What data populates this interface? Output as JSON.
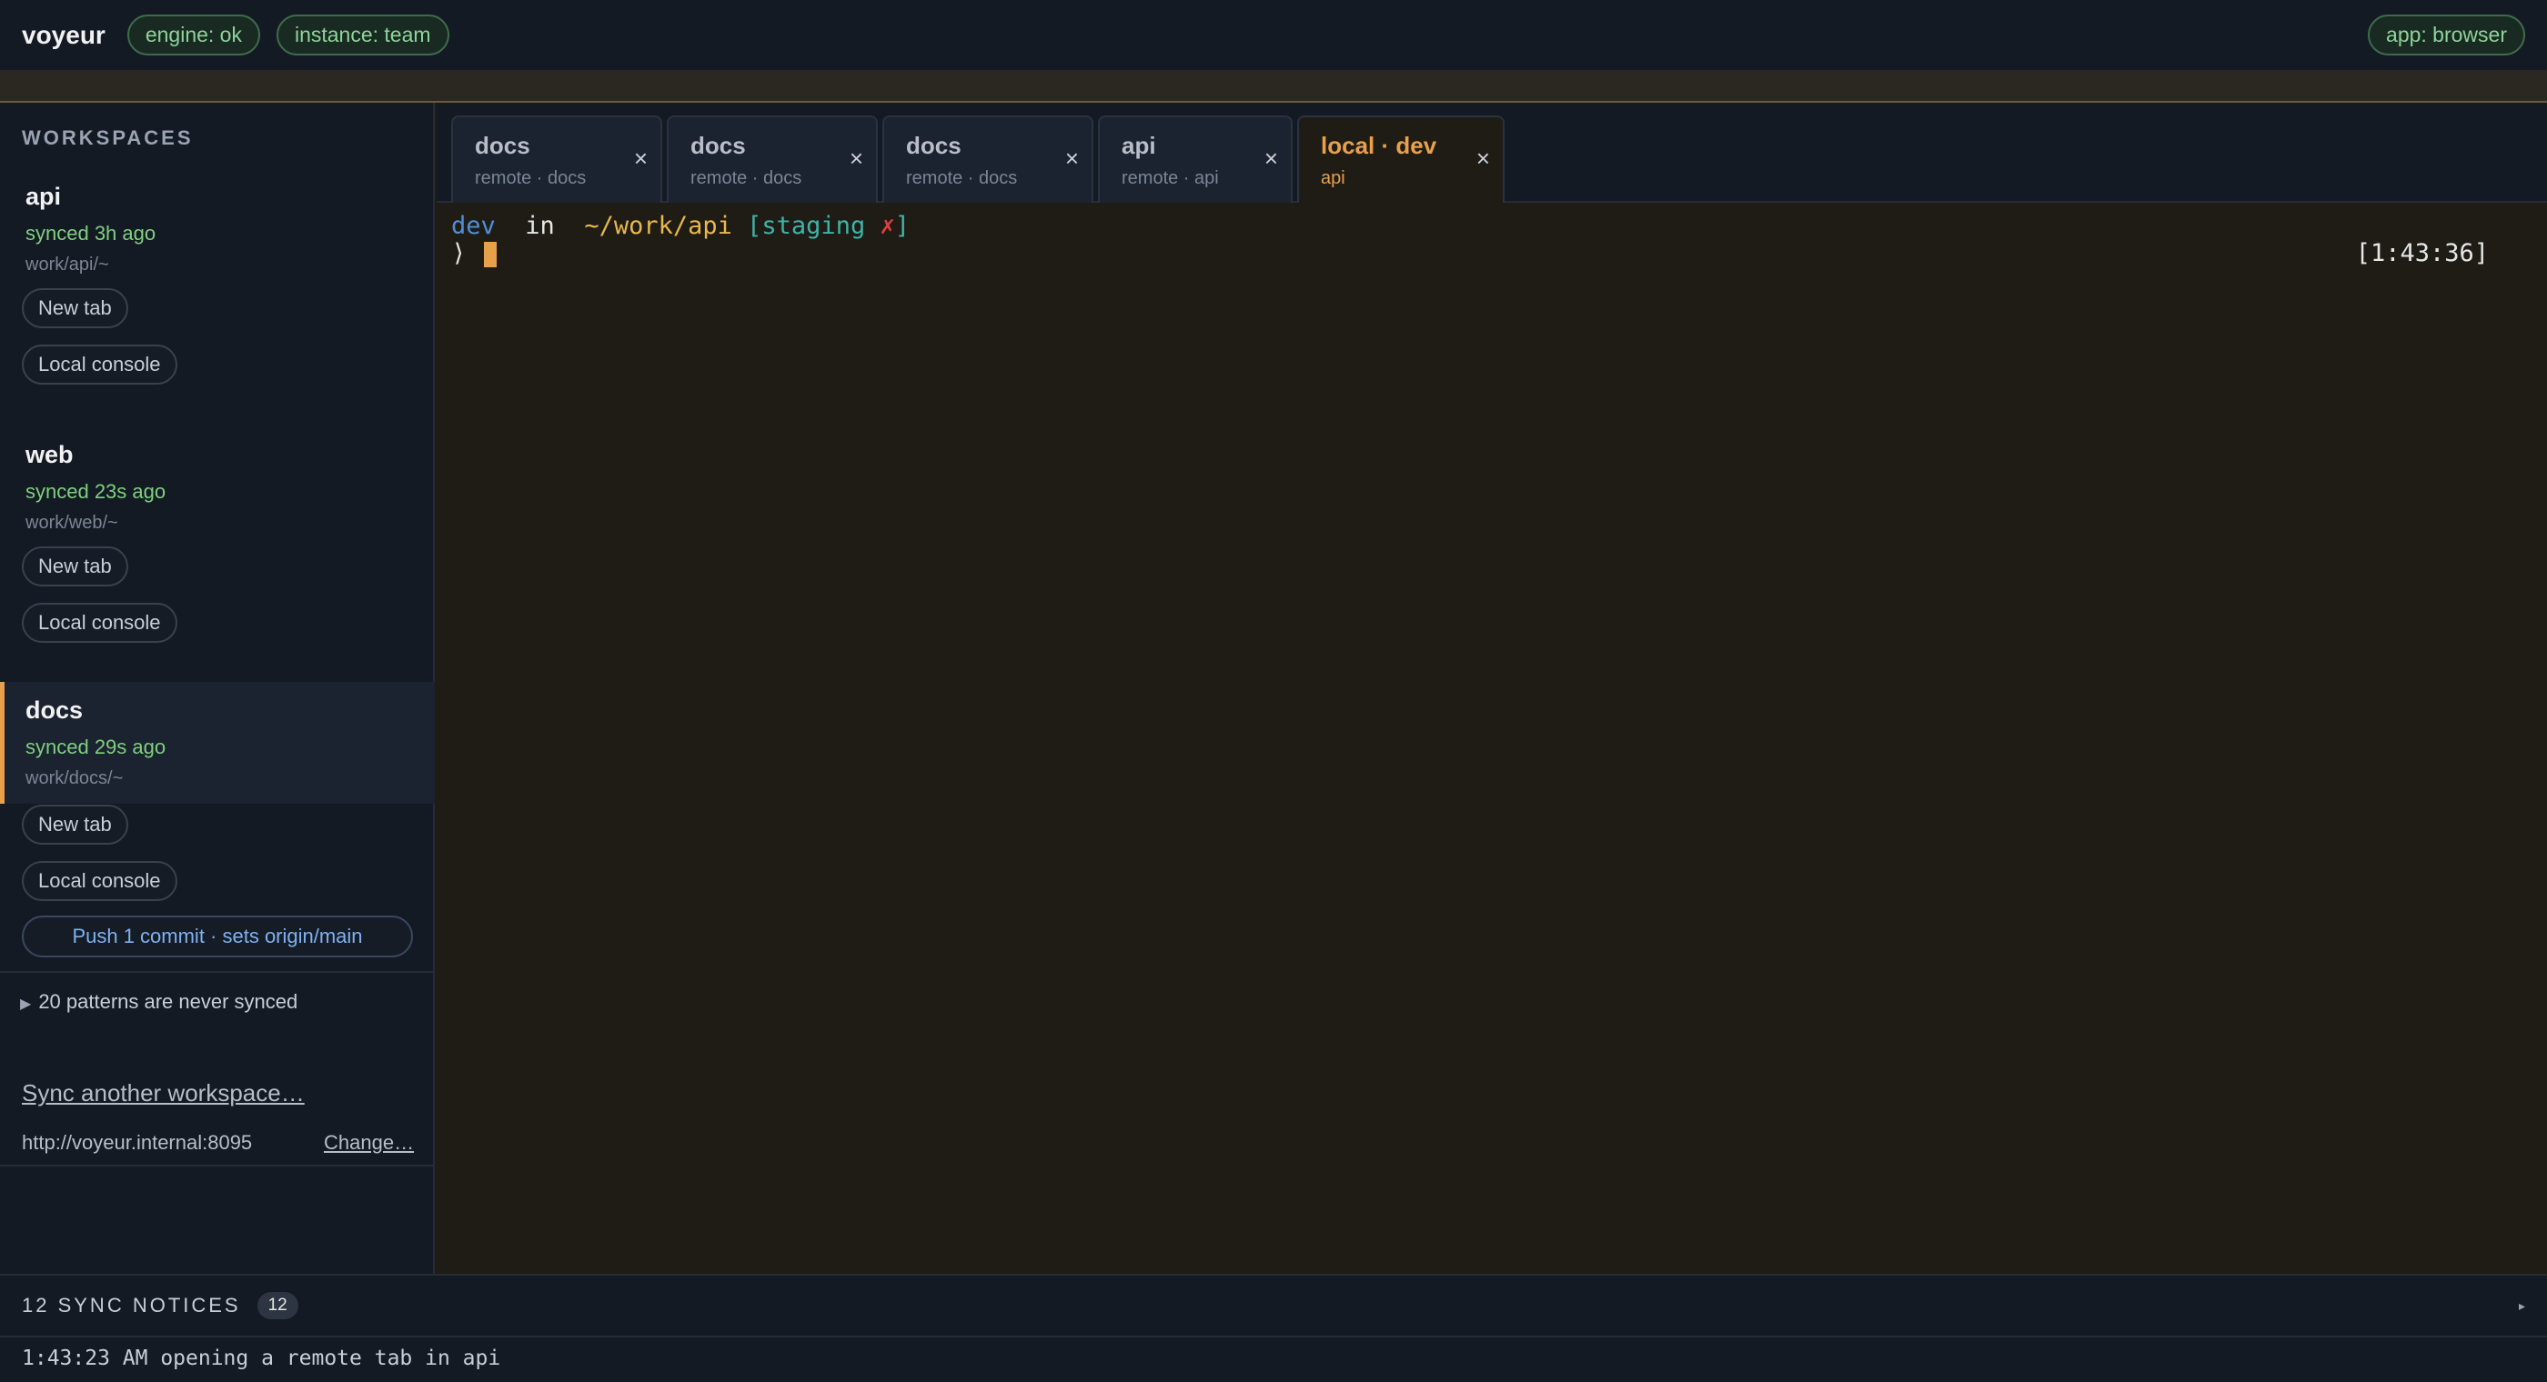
{
  "topbar": {
    "brand": "voyeur",
    "engine": "engine: ok",
    "instance": "instance: team",
    "app": "app: browser"
  },
  "sidebar": {
    "title": "WORKSPACES",
    "workspaces": [
      {
        "name": "api",
        "sync": "synced 3h ago",
        "path": "work/api/~",
        "new_tab": "New tab",
        "console": "Local console"
      },
      {
        "name": "web",
        "sync": "synced 23s ago",
        "path": "work/web/~",
        "new_tab": "New tab",
        "console": "Local console"
      },
      {
        "name": "docs",
        "sync": "synced 29s ago",
        "path": "work/docs/~",
        "new_tab": "New tab",
        "console": "Local console",
        "push": "Push 1 commit · sets origin/main"
      }
    ],
    "patterns": "20 patterns are never synced",
    "sync_another": "Sync another workspace…",
    "url": "http://voyeur.internal:8095",
    "change": "Change…"
  },
  "tabs": [
    {
      "title": "docs",
      "sub": "remote · docs",
      "close": "×"
    },
    {
      "title": "docs",
      "sub": "remote · docs",
      "close": "×"
    },
    {
      "title": "docs",
      "sub": "remote · docs",
      "close": "×"
    },
    {
      "title": "api",
      "sub": "remote · api",
      "close": "×"
    },
    {
      "title": "local · dev",
      "sub": "api",
      "close": "×"
    }
  ],
  "terminal": {
    "user": "dev",
    "in": "in",
    "path": "~/work/api",
    "branch_open": "[staging",
    "branch_mark": "✗",
    "branch_close": "]",
    "prompt": "⟩",
    "time": "[1:43:36]"
  },
  "notices": {
    "title": "12 SYNC NOTICES",
    "count": "12",
    "toggle": "▸"
  },
  "log": {
    "line": "1:43:23 AM opening a remote tab in api"
  },
  "colors": {
    "accent": "#e8a04a",
    "sync_green": "#7fd07f",
    "link_blue": "#7fb1f0"
  }
}
